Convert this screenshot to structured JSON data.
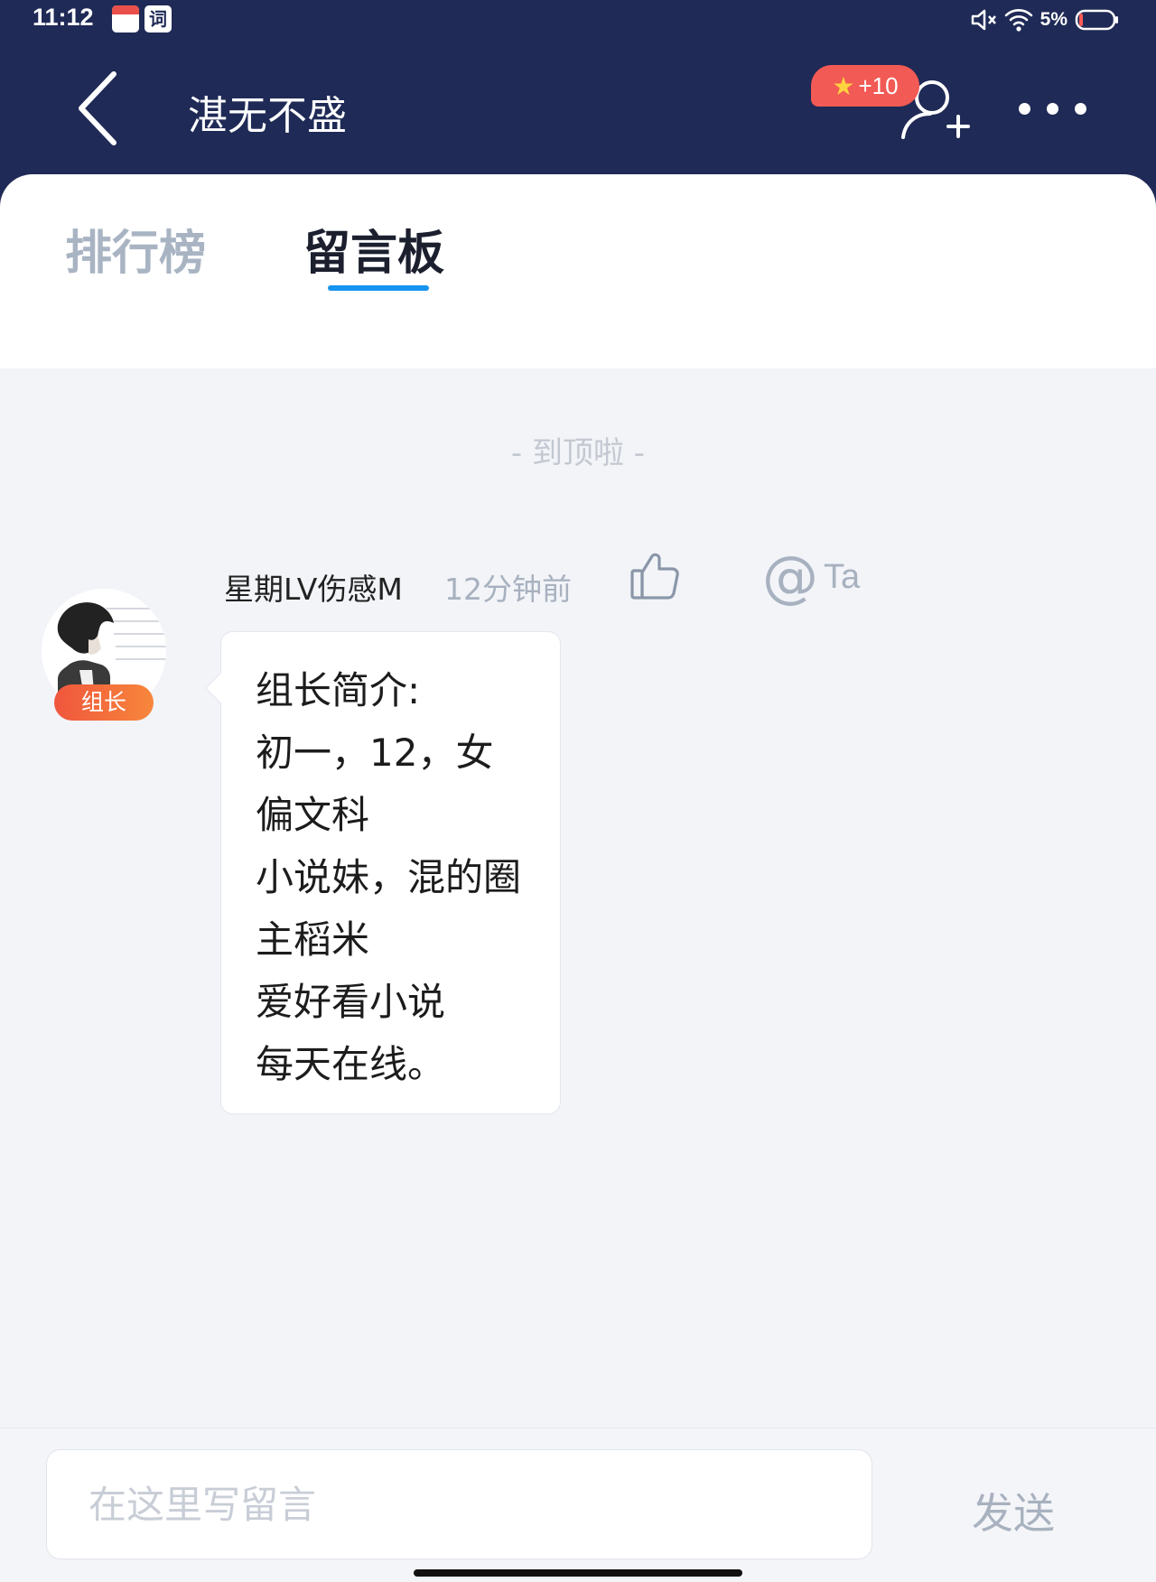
{
  "status_bar": {
    "time": "11:12",
    "notification_icons": [
      "calendar-icon",
      "ci-dictionary-icon"
    ],
    "ci_glyph": "词",
    "battery_percent": "5%",
    "icons": [
      "mute-icon",
      "wifi-icon",
      "battery-icon"
    ]
  },
  "header": {
    "title": "湛无不盛",
    "points_badge": "+10",
    "icons": [
      "back-icon",
      "star-icon",
      "add-user-icon",
      "more-icon"
    ]
  },
  "tabs": [
    {
      "label": "排行榜",
      "active": false
    },
    {
      "label": "留言板",
      "active": true
    }
  ],
  "feed": {
    "top_note": "- 到顶啦 -",
    "messages": [
      {
        "username": "星期LV伤感M",
        "time": "12分钟前",
        "role_badge": "组长",
        "at_label": "Ta",
        "lines": [
          "组长简介:",
          "初一，12，女",
          "偏文科",
          "小说妹，混的圈",
          "主稻米",
          "爱好看小说",
          "每天在线。"
        ]
      }
    ]
  },
  "composer": {
    "placeholder": "在这里写留言",
    "value": "",
    "send_label": "发送"
  },
  "colors": {
    "header_bg": "#1f2a56",
    "tab_accent": "#1793f0",
    "badge_red": "#f25a55",
    "role_badge": "#f0563d",
    "muted_text": "#a8b1bf",
    "page_bg": "#f2f4f8"
  }
}
